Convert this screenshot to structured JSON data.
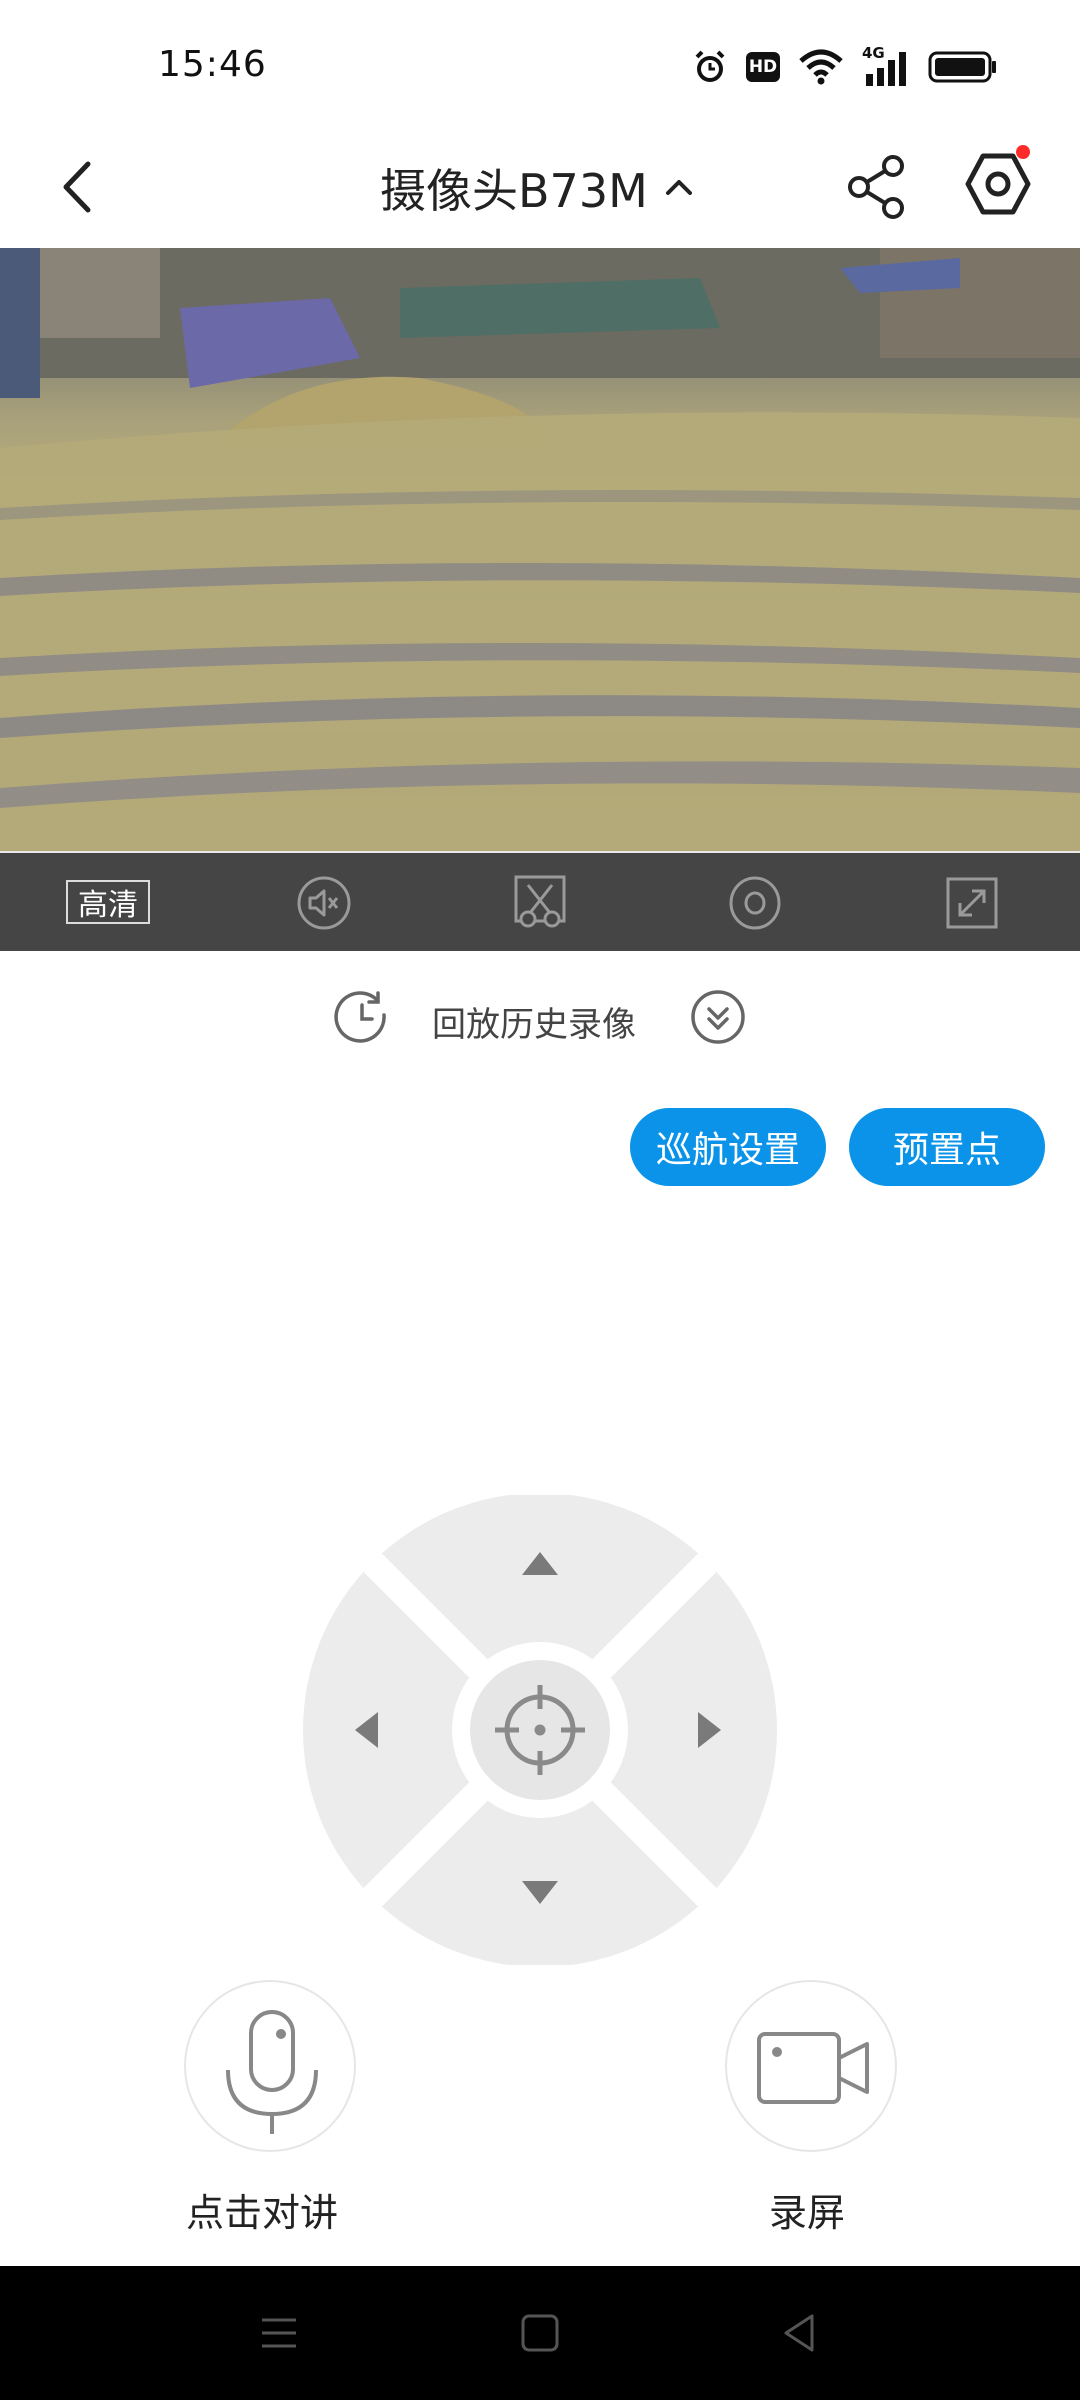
{
  "status_bar": {
    "time": "15:46",
    "icons": [
      "alarm-icon",
      "hd-icon",
      "wifi-icon",
      "signal-4g-icon",
      "battery-icon"
    ],
    "network_label": "4G",
    "hd_label": "HD"
  },
  "header": {
    "title": "摄像头B73M",
    "back_icon": "back-icon",
    "share_icon": "share-icon",
    "settings_icon": "settings-icon",
    "settings_badge_color": "#ff2a2a"
  },
  "video": {
    "description": "live-camera-feed"
  },
  "controls": {
    "quality_label": "高清",
    "icons": [
      "mute-icon",
      "screenshot-icon",
      "view-icon",
      "fullscreen-icon"
    ]
  },
  "playback": {
    "label": "回放历史录像",
    "clock_icon": "clock-icon",
    "expand_icon": "expand-icon"
  },
  "buttons": {
    "cruise_label": "巡航设置",
    "preset_label": "预置点",
    "accent_color": "#0a93e8"
  },
  "ptz": {
    "icons": [
      "up-arrow-icon",
      "left-arrow-icon",
      "right-arrow-icon",
      "down-arrow-icon",
      "crosshair-icon"
    ]
  },
  "actions": {
    "talk_label": "点击对讲",
    "record_label": "录屏"
  },
  "nav": {
    "icons": [
      "menu-icon",
      "home-icon",
      "back-nav-icon"
    ]
  }
}
